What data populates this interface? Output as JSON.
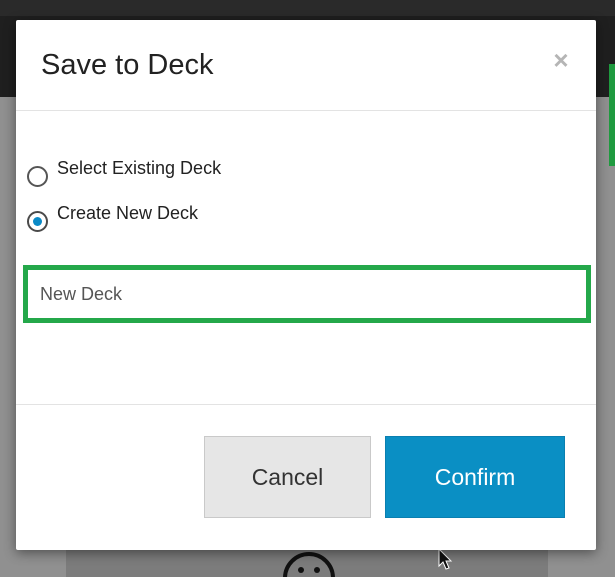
{
  "colors": {
    "accent": "#0a8fc4",
    "focus_border": "#24a84a",
    "cancel_bg": "#e6e6e6"
  },
  "dialog": {
    "title": "Save to Deck",
    "close_icon": "close-icon",
    "close_label": "×",
    "options": [
      {
        "label": "Select Existing Deck",
        "checked": false
      },
      {
        "label": "Create New Deck",
        "checked": true
      }
    ],
    "deck_name": {
      "value": "New Deck",
      "placeholder": ""
    },
    "buttons": {
      "cancel": "Cancel",
      "confirm": "Confirm"
    }
  }
}
